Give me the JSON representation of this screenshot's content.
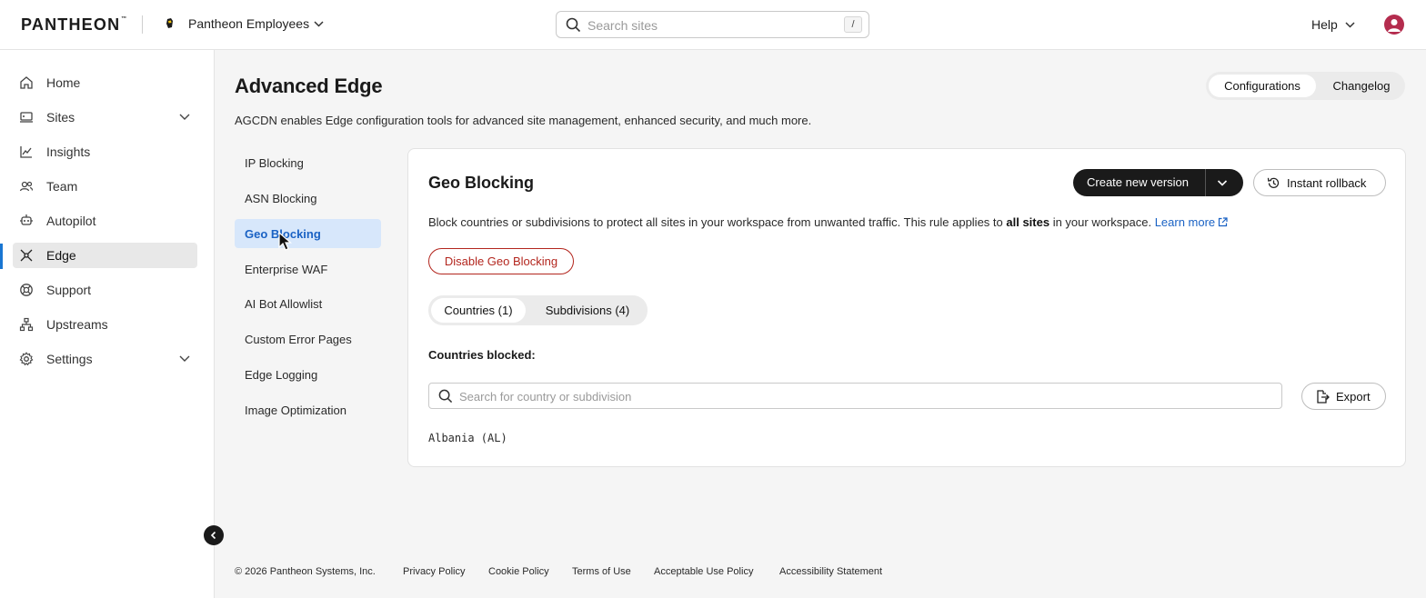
{
  "header": {
    "logo": "PANTHEON",
    "logo_tm": "™",
    "workspace": "Pantheon Employees",
    "search_placeholder": "Search sites",
    "search_shortcut": "/",
    "help_label": "Help"
  },
  "sidebar": {
    "items": [
      {
        "label": "Home",
        "icon": "home-icon"
      },
      {
        "label": "Sites",
        "icon": "sites-icon",
        "expandable": true
      },
      {
        "label": "Insights",
        "icon": "insights-icon"
      },
      {
        "label": "Team",
        "icon": "team-icon"
      },
      {
        "label": "Autopilot",
        "icon": "autopilot-icon"
      },
      {
        "label": "Edge",
        "icon": "edge-icon",
        "active": true
      },
      {
        "label": "Support",
        "icon": "support-icon"
      },
      {
        "label": "Upstreams",
        "icon": "upstreams-icon"
      },
      {
        "label": "Settings",
        "icon": "settings-icon",
        "expandable": true
      }
    ]
  },
  "page": {
    "title": "Advanced Edge",
    "description": "AGCDN enables Edge configuration tools for advanced site management, enhanced security, and much more.",
    "toggle": {
      "configurations": "Configurations",
      "changelog": "Changelog",
      "selected": "Configurations"
    }
  },
  "subnav": {
    "items": [
      {
        "label": "IP Blocking"
      },
      {
        "label": "ASN Blocking"
      },
      {
        "label": "Geo Blocking",
        "active": true
      },
      {
        "label": "Enterprise WAF"
      },
      {
        "label": "AI Bot Allowlist"
      },
      {
        "label": "Custom Error Pages"
      },
      {
        "label": "Edge Logging"
      },
      {
        "label": "Image Optimization"
      }
    ]
  },
  "card": {
    "title": "Geo Blocking",
    "create_version": "Create new version",
    "rollback": "Instant rollback",
    "desc_before": "Block countries or subdivisions to protect all sites in your workspace from unwanted traffic. This rule applies to ",
    "desc_bold": "all sites",
    "desc_after": " in your workspace. ",
    "learn_more": "Learn more",
    "disable": "Disable Geo Blocking",
    "tabs": [
      {
        "label": "Countries (1)",
        "selected": true
      },
      {
        "label": "Subdivisions (4)"
      }
    ],
    "blocked_label": "Countries blocked:",
    "search_placeholder": "Search for country or subdivision",
    "export": "Export",
    "countries": [
      "Albania (AL)"
    ]
  },
  "footer": {
    "copyright": "© 2026 Pantheon Systems, Inc.",
    "links": [
      "Privacy Policy",
      "Cookie Policy",
      "Terms of Use",
      "Acceptable Use Policy",
      "Accessibility Statement"
    ]
  },
  "colors": {
    "accent_blue": "#1a62c4",
    "active_indicator": "#1976d2",
    "danger": "#b3261e",
    "avatar": "#b42c4e",
    "primary_button": "#1a1a1a"
  }
}
